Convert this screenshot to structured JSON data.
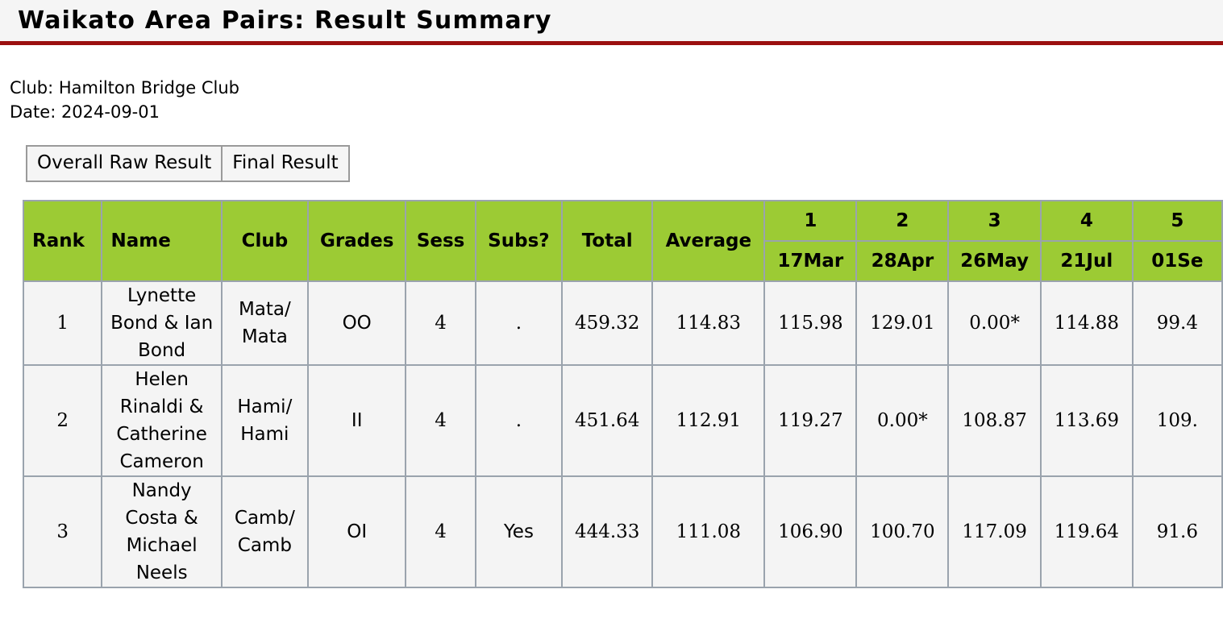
{
  "page": {
    "title": "Waikato Area Pairs: Result Summary",
    "club_line": "Club: Hamilton Bridge Club",
    "date_line": "Date: 2024-09-01",
    "accent_color": "#9b0f0f",
    "header_color": "#9ccb34",
    "row_color": "#f4f4f4"
  },
  "tabs": [
    {
      "label": "Overall Raw Result"
    },
    {
      "label": "Final Result"
    }
  ],
  "table": {
    "columns": [
      {
        "key": "rank",
        "label": "Rank"
      },
      {
        "key": "name",
        "label": "Name"
      },
      {
        "key": "club",
        "label": "Club"
      },
      {
        "key": "grades",
        "label": "Grades"
      },
      {
        "key": "sess",
        "label": "Sess"
      },
      {
        "key": "subs",
        "label": "Subs?"
      },
      {
        "key": "total",
        "label": "Total"
      },
      {
        "key": "average",
        "label": "Average"
      }
    ],
    "session_columns": [
      {
        "number": "1",
        "date": "17Mar"
      },
      {
        "number": "2",
        "date": "28Apr"
      },
      {
        "number": "3",
        "date": "26May"
      },
      {
        "number": "4",
        "date": "21Jul"
      },
      {
        "number": "5",
        "date": "01Se"
      }
    ],
    "rows": [
      {
        "rank": "1",
        "name": "Lynette Bond & Ian Bond",
        "club": "Mata/ Mata",
        "grades": "OO",
        "sess": "4",
        "subs": ".",
        "total": "459.32",
        "average": "114.83",
        "sessions": [
          "115.98",
          "129.01",
          "0.00*",
          "114.88",
          "99.4"
        ]
      },
      {
        "rank": "2",
        "name": "Helen Rinaldi & Catherine Cameron",
        "club": "Hami/ Hami",
        "grades": "II",
        "sess": "4",
        "subs": ".",
        "total": "451.64",
        "average": "112.91",
        "sessions": [
          "119.27",
          "0.00*",
          "108.87",
          "113.69",
          "109."
        ]
      },
      {
        "rank": "3",
        "name": "Nandy Costa & Michael Neels",
        "club": "Camb/ Camb",
        "grades": "OI",
        "sess": "4",
        "subs": "Yes",
        "total": "444.33",
        "average": "111.08",
        "sessions": [
          "106.90",
          "100.70",
          "117.09",
          "119.64",
          "91.6"
        ]
      }
    ]
  }
}
